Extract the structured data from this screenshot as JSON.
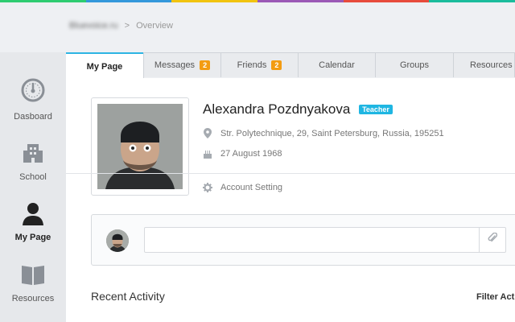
{
  "colors": {
    "accent": "#2db4e3",
    "badge": "#f39c12",
    "teacher_badge": "#1fb6e2",
    "stripe": [
      "#2ecc71",
      "#3498db",
      "#f1c40f",
      "#9b59b6",
      "#e74c3c",
      "#1abc9c"
    ]
  },
  "breadcrumb": {
    "root": "Bluevoice.ru",
    "separator": ">",
    "current": "Overview"
  },
  "sidebar": {
    "items": [
      {
        "label": "Dasboard",
        "icon": "dashboard-icon"
      },
      {
        "label": "School",
        "icon": "school-icon"
      },
      {
        "label": "My Page",
        "icon": "user-icon"
      },
      {
        "label": "Resources",
        "icon": "book-icon"
      }
    ]
  },
  "tabs": [
    {
      "label": "My Page",
      "badge": ""
    },
    {
      "label": "Messages",
      "badge": "2"
    },
    {
      "label": "Friends",
      "badge": "2"
    },
    {
      "label": "Calendar",
      "badge": ""
    },
    {
      "label": "Groups",
      "badge": ""
    },
    {
      "label": "Resources",
      "badge": ""
    }
  ],
  "profile": {
    "name": "Alexandra Pozdnyakova",
    "role": "Teacher",
    "address": "Str. Polytechnique, 29, Saint Petersburg, Russia, 195251",
    "birthday": "27 August 1968",
    "account_setting": "Account Setting"
  },
  "composer": {
    "placeholder": ""
  },
  "activity": {
    "title": "Recent Activity",
    "filter": "Filter Acti"
  }
}
